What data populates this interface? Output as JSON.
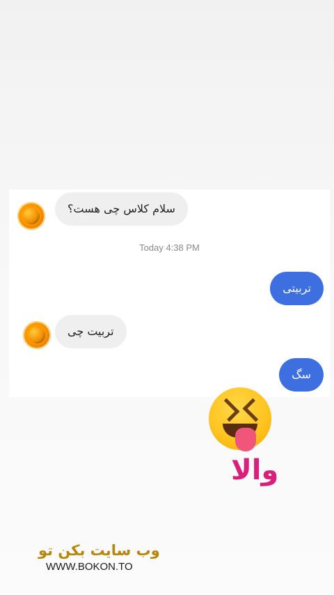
{
  "messages": [
    {
      "direction": "in",
      "text": "سلام کلاس چی هست؟"
    },
    {
      "direction": "out",
      "text": "تربیتی"
    },
    {
      "direction": "in",
      "text": "تربیت چی"
    },
    {
      "direction": "out",
      "text": "سگ"
    }
  ],
  "timestamp": "Today 4:38 PM",
  "overlay": {
    "emoji": "squinting-face-with-tongue-icon",
    "caption": "والا"
  },
  "watermark": {
    "title": "وب سایت بکن تو",
    "url": "WWW.BOKON.TO"
  },
  "colors": {
    "outgoing_bubble": "#3d6fe0",
    "incoming_bubble": "#efefef",
    "caption": "#d91f7a",
    "watermark_title": "#b8860b"
  }
}
